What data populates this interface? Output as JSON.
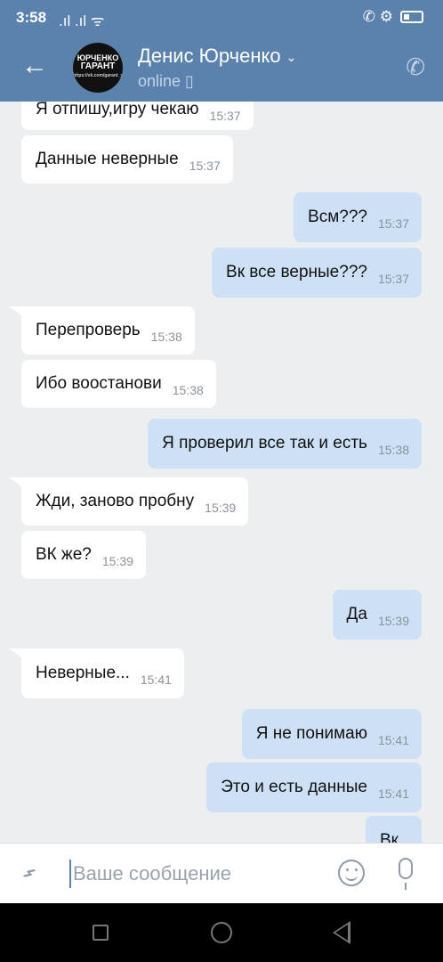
{
  "statusbar": {
    "time": "3:58",
    "signal": ".ıl .ıl ᯤ",
    "right_icons": "✆ ⚙"
  },
  "header": {
    "back_icon": "arrow-left-icon",
    "avatar": {
      "line1": "ЮРЧЕНКО",
      "line2": "ГАРАНТ",
      "line3": "https://vk.com/garant_yrchen"
    },
    "name": "Денис Юрченко",
    "chevron": "⌄",
    "status": "online ▯",
    "phone_icon": "phone-icon"
  },
  "messages": [
    {
      "dir": "in",
      "text": "Я отпишу,игру чекаю",
      "time": "15:37"
    },
    {
      "dir": "in",
      "text": "Данные неверные",
      "time": "15:37"
    },
    {
      "dir": "out",
      "text": "Всм???",
      "time": "15:37"
    },
    {
      "dir": "out",
      "text": "Вк все верные???",
      "time": "15:37"
    },
    {
      "dir": "in",
      "text": "Перепроверь",
      "time": "15:38"
    },
    {
      "dir": "in",
      "text": "Ибо воостанови",
      "time": "15:38"
    },
    {
      "dir": "out",
      "text": "Я проверил все так и есть",
      "time": "15:38"
    },
    {
      "dir": "in",
      "text": "Жди, заново пробну",
      "time": "15:39"
    },
    {
      "dir": "in",
      "text": "ВК же?",
      "time": "15:39"
    },
    {
      "dir": "out",
      "text": "Да",
      "time": "15:39"
    },
    {
      "dir": "in",
      "text": "Неверные...",
      "time": "15:41"
    },
    {
      "dir": "out",
      "text": "Я не понимаю",
      "time": "15:41"
    },
    {
      "dir": "out",
      "text": "Это и есть данные",
      "time": "15:41"
    },
    {
      "dir": "out",
      "text": "Вк",
      "time": ""
    }
  ],
  "input": {
    "placeholder": "Ваше сообщение",
    "attach_icon": "paperclip-icon",
    "emoji_icon": "smile-icon",
    "mic_icon": "microphone-icon"
  },
  "colors": {
    "header": "#5b82ad",
    "incoming": "#ffffff",
    "outgoing": "#cde0f5",
    "background": "#edeef0"
  }
}
